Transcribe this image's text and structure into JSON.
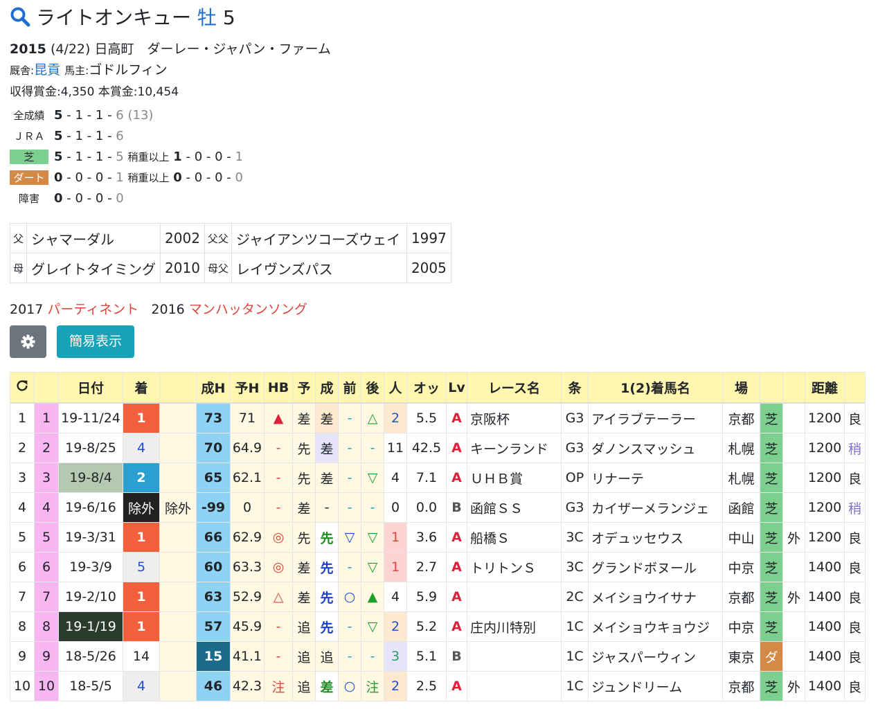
{
  "horse": {
    "name": "ライトオンキュー",
    "sex_age_sex": "牡",
    "sex_age_age": "5"
  },
  "profile": {
    "year": "2015",
    "birthday": "(4/22)",
    "origin": "日高町　ダーレー・ジャパン・ファーム",
    "stable_label": "厩舎:",
    "trainer": "昆貢",
    "owner_label": "馬主:",
    "owner": "ゴドルフィン",
    "prize": "収得賞金:4,350 本賞金:10,454"
  },
  "records": [
    {
      "label": "全成績",
      "w": "5",
      "s": "1",
      "t": "1",
      "o": "6 (13)"
    },
    {
      "label": "ＪＲＡ",
      "w": "5",
      "s": "1",
      "t": "1",
      "o": "6"
    },
    {
      "label": "芝",
      "w": "5",
      "s": "1",
      "t": "1",
      "o": "5",
      "ex_label": "稍重以上",
      "ew": "1",
      "es": "0",
      "et": "0",
      "eo": "1"
    },
    {
      "label": "ダート",
      "w": "0",
      "s": "0",
      "t": "0",
      "o": "1",
      "ex_label": "稍重以上",
      "ew": "0",
      "es": "0",
      "et": "0",
      "eo": "0"
    },
    {
      "label": "障害",
      "w": "0",
      "s": "0",
      "t": "0",
      "o": "0"
    }
  ],
  "pedigree": {
    "sire_k": "父",
    "sire": "シャマーダル",
    "sire_y": "2002",
    "sire_sire_k": "父父",
    "sire_sire": "ジャイアンツコーズウェイ",
    "sire_sire_y": "1997",
    "dam_k": "母",
    "dam": "グレイトタイミング",
    "dam_y": "2010",
    "dam_sire_k": "母父",
    "dam_sire": "レイヴンズパス",
    "dam_sire_y": "2005"
  },
  "siblings": [
    {
      "year": "2017",
      "name": "パーティネント"
    },
    {
      "year": "2016",
      "name": "マンハッタンソング"
    }
  ],
  "buttons": {
    "gear_icon": "gear-icon",
    "simple": "簡易表示"
  },
  "table": {
    "headers": [
      "⟳",
      "",
      "日付",
      "着",
      "",
      "成H",
      "予H",
      "HB",
      "予",
      "成",
      "前",
      "後",
      "人",
      "オッ",
      "Lv",
      "レース名",
      "条",
      "1(2)着馬名",
      "場",
      "",
      "",
      "距離",
      ""
    ],
    "rows": [
      [
        "1",
        "1",
        "19-11/24",
        "1",
        "",
        "73",
        "71",
        "▲",
        "差",
        "差",
        "-",
        "△",
        "2",
        "5.5",
        "A",
        "京阪杯",
        "G3",
        "アイラブテーラー",
        "京都",
        "芝",
        "",
        "1200",
        "良"
      ],
      [
        "2",
        "2",
        "19-8/25",
        "4",
        "",
        "70",
        "64.9",
        "-",
        "先",
        "差",
        "-",
        "-",
        "11",
        "42.5",
        "A",
        "キーンランド",
        "G3",
        "ダノンスマッシュ",
        "札幌",
        "芝",
        "",
        "1200",
        "稍"
      ],
      [
        "3",
        "3",
        "19-8/4",
        "2",
        "",
        "65",
        "62.1",
        "-",
        "先",
        "差",
        "-",
        "▽",
        "4",
        "7.1",
        "A",
        "ＵＨＢ賞",
        "OP",
        "リナーテ",
        "札幌",
        "芝",
        "",
        "1200",
        "良"
      ],
      [
        "4",
        "4",
        "19-6/16",
        "除外",
        "除外",
        "-99",
        "0",
        "-",
        "差",
        "-",
        "-",
        "-",
        "0",
        "0.0",
        "B",
        "函館ＳＳ",
        "G3",
        "カイザーメランジェ",
        "函館",
        "芝",
        "",
        "1200",
        "稍"
      ],
      [
        "5",
        "5",
        "19-3/31",
        "1",
        "",
        "66",
        "62.9",
        "◎",
        "先",
        "先",
        "▽",
        "▽",
        "1",
        "3.6",
        "A",
        "船橋Ｓ",
        "3C",
        "オデュッセウス",
        "中山",
        "芝",
        "外",
        "1200",
        "良"
      ],
      [
        "6",
        "6",
        "19-3/9",
        "5",
        "",
        "60",
        "63.3",
        "◎",
        "差",
        "先",
        "-",
        "▽",
        "1",
        "2.7",
        "A",
        "トリトンＳ",
        "3C",
        "グランドボヌール",
        "中京",
        "芝",
        "",
        "1400",
        "良"
      ],
      [
        "7",
        "7",
        "19-2/10",
        "1",
        "",
        "63",
        "52.9",
        "△",
        "差",
        "先",
        "○",
        "▲",
        "4",
        "5.9",
        "A",
        "",
        "2C",
        "メイショウイサナ",
        "京都",
        "芝",
        "外",
        "1400",
        "良"
      ],
      [
        "8",
        "8",
        "19-1/19",
        "1",
        "",
        "57",
        "45.9",
        "-",
        "追",
        "先",
        "-",
        "▽",
        "2",
        "5.2",
        "A",
        "庄内川特別",
        "1C",
        "メイショウキョウジ",
        "中京",
        "芝",
        "",
        "1400",
        "良"
      ],
      [
        "9",
        "9",
        "18-5/26",
        "14",
        "",
        "15",
        "41.1",
        "-",
        "追",
        "追",
        "-",
        "-",
        "3",
        "5.1",
        "B",
        "",
        "1C",
        "ジャスパーウィン",
        "東京",
        "ダ",
        "",
        "1400",
        "良"
      ],
      [
        "10",
        "10",
        "18-5/5",
        "4",
        "",
        "46",
        "42.3",
        "注",
        "追",
        "差",
        "○",
        "注",
        "2",
        "2.5",
        "A",
        "",
        "1C",
        "ジュンドリーム",
        "京都",
        "芝",
        "外",
        "1400",
        "良"
      ]
    ]
  }
}
